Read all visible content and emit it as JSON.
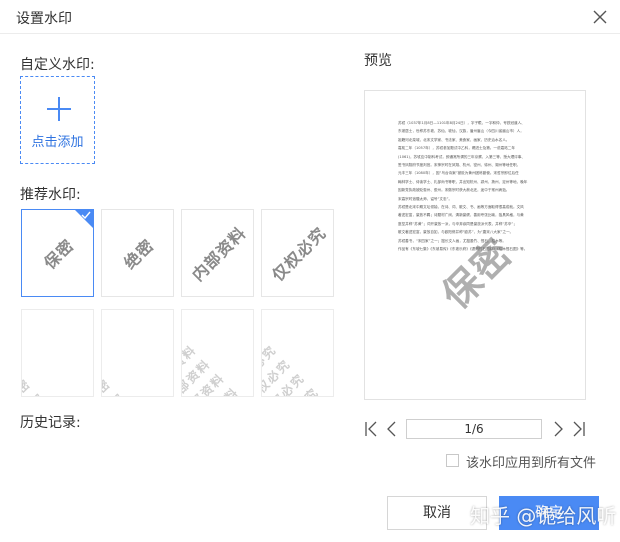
{
  "dialog": {
    "title": "设置水印"
  },
  "custom": {
    "label": "自定义水印:",
    "add_label": "点击添加"
  },
  "recommended": {
    "label": "推荐水印:",
    "single": [
      "保密",
      "绝密",
      "内部资料",
      "仅权必究"
    ],
    "tiled": [
      "保密",
      "绝密",
      "内部资料",
      "仅权必究"
    ]
  },
  "history": {
    "label": "历史记录:"
  },
  "preview": {
    "label": "预览",
    "watermark": "保密",
    "doc_lines": [
      "苏轼（1037年1月8日—1101年8月24日），字子瞻，一字和仲，号铁冠道人、",
      "东坡居士，世称苏东坡、苏仙、坡仙，汉族，眉州眉山（今四川省眉山市）人，",
      "祖籍河北栾城，北宋文学家、书法家、美食家、画家，历史治水名人。",
      "嘉祐二年（1057年），苏轼参加殿试中乙科，赐进士及第。一说嘉祐二年",
      "(1061)，苏轼应中制科考试，即通常所谓的三年京察，入第三等，授大理评事、",
      "签书凤翔府节度判官。宋神宗时在凤翔、杭州、密州、徐州、湖州等地任职。",
      "元丰三年（1080年），因“乌台诗案”被贬为黄州团练副使。宋哲宗即位后任",
      "翰林学士、侍读学士、礼部尚书等职，并出知杭州、颍州、扬州、定州等地，晚年",
      "因新党执政被贬惠州、儋州。宋徽宗时获大赦北还，途中于常州病逝。",
      "宋高宗时追赠太师，谥号“文忠”。",
      "苏轼是北宋中期文坛领袖，在诗、词、散文、书、画等方面取得很高成就。文风",
      "著述宏富，豪放不羁；诗题材广阔，清新豪健，善用夸张比喻，独具风格，与黄",
      "庭坚并称“苏黄”；词开豪放一派，与辛弃疾同是豪放派代表，并称“苏辛”；",
      "散文著述宏富，豪放自如，与欧阳修并称“欧苏”，为“唐宋八大家”之一。",
      "苏轼善书，“宋四家”之一；擅长文人画，尤擅墨竹、怪石、枯木等。",
      "作品有《东坡七集》《东坡易传》《东坡乐府》《潇湘竹石图卷》《枯木怪石图》等。"
    ]
  },
  "pager": {
    "page": "1/6"
  },
  "apply_all": {
    "label": "该水印应用到所有文件"
  },
  "buttons": {
    "cancel": "取消",
    "ok": "确定"
  },
  "overlay": {
    "watermark_text": "知乎 @诡给风听"
  },
  "colors": {
    "accent": "#4a8af4",
    "border": "#e6e6e6"
  }
}
